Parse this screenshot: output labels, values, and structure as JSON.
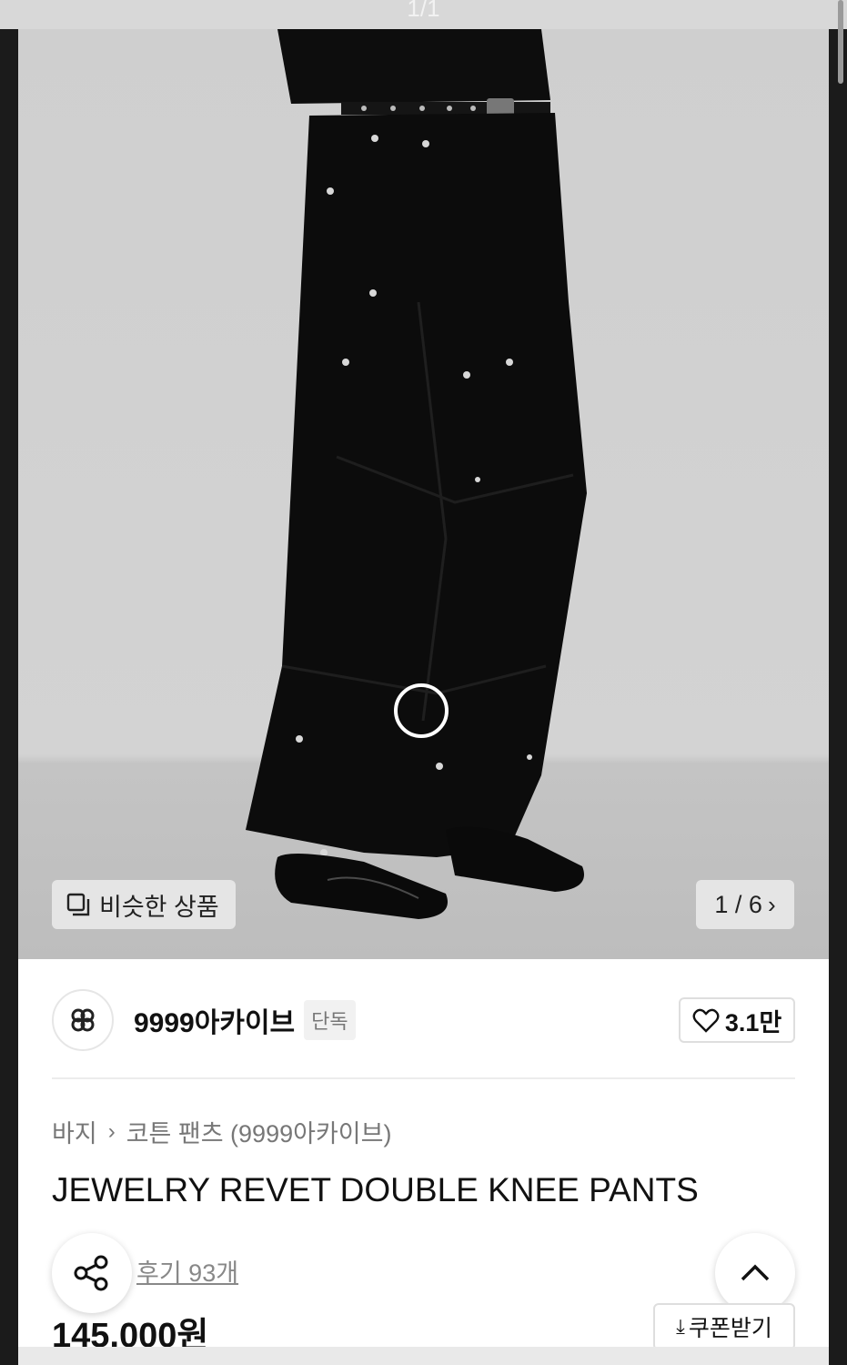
{
  "top": {
    "counter": "1/1"
  },
  "image": {
    "similar_label": "비슷한 상품",
    "pager_current": "1",
    "pager_total": "6",
    "pager_text": "1 / 6"
  },
  "brand": {
    "name": "9999아카이브",
    "badge": "단독",
    "likes": "3.1만"
  },
  "breadcrumb": {
    "category": "바지",
    "subcategory": "코튼 팬츠 (9999아카이브)"
  },
  "product": {
    "title": "JEWELRY REVET DOUBLE KNEE PANTS",
    "reviews": "후기 93개",
    "price": "145,000원",
    "coupon_label": "쿠폰받기"
  },
  "icons": {
    "similar": "similar-products-icon",
    "pager": "chevron-right-icon",
    "like": "heart-icon",
    "share": "share-icon",
    "up": "chevron-up-icon",
    "coupon": "download-icon",
    "loading": "loading-ring-icon"
  }
}
